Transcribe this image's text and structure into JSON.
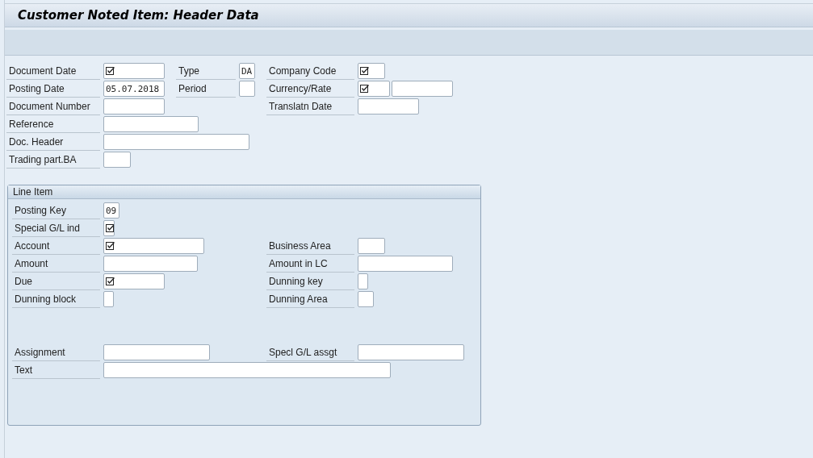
{
  "window": {
    "title": "Customer Noted Item: Header Data"
  },
  "header": {
    "rows": [
      {
        "left": {
          "label": "Document Date",
          "inputs": [
            {
              "required": true
            }
          ]
        },
        "middle": {
          "label": "Type",
          "inputs": [
            {
              "value": "DA",
              "required": false
            }
          ]
        },
        "right": {
          "label": "Company Code",
          "inputs": [
            {
              "required": true
            }
          ]
        }
      },
      {
        "left": {
          "label": "Posting Date",
          "inputs": [
            {
              "value": "05.07.2018",
              "required": false
            }
          ]
        },
        "middle": {
          "label": "Period",
          "inputs": [
            {
              "required": false
            }
          ]
        },
        "right": {
          "label": "Currency/Rate",
          "inputs": [
            {
              "required": true
            },
            {
              "required": false
            }
          ]
        }
      },
      {
        "left": {
          "label": "Document Number",
          "inputs": [
            {
              "required": false
            }
          ]
        },
        "right": {
          "label": "Translatn Date",
          "inputs": [
            {
              "required": false
            }
          ]
        }
      },
      {
        "left": {
          "label": "Reference",
          "inputs": [
            {
              "required": false
            }
          ]
        }
      },
      {
        "left": {
          "label": "Doc. Header",
          "inputs": [
            {
              "required": false
            }
          ]
        }
      },
      {
        "left": {
          "label": "Trading part.BA",
          "inputs": [
            {
              "required": false
            }
          ]
        }
      }
    ]
  },
  "line_item": {
    "title": "Line Item",
    "rows": [
      {
        "left": {
          "label": "Posting Key",
          "inputs": [
            {
              "value": "09",
              "required": false
            }
          ]
        }
      },
      {
        "left": {
          "label": "Special G/L ind",
          "inputs": [
            {
              "required": true
            }
          ]
        }
      },
      {
        "left": {
          "label": "Account",
          "inputs": [
            {
              "required": true
            }
          ]
        },
        "right": {
          "label": "Business Area",
          "inputs": [
            {
              "required": false
            }
          ]
        }
      },
      {
        "left": {
          "label": "Amount",
          "inputs": [
            {
              "required": false
            }
          ]
        },
        "right": {
          "label": "Amount in LC",
          "inputs": [
            {
              "required": false
            }
          ]
        }
      },
      {
        "left": {
          "label": "Due",
          "inputs": [
            {
              "required": true
            }
          ]
        },
        "right": {
          "label": "Dunning key",
          "inputs": [
            {
              "required": false
            }
          ]
        }
      },
      {
        "left": {
          "label": "Dunning block",
          "inputs": [
            {
              "required": false
            }
          ]
        },
        "right": {
          "label": "Dunning Area",
          "inputs": [
            {
              "required": false
            }
          ]
        }
      }
    ],
    "bottom_rows": [
      {
        "left": {
          "label": "Assignment",
          "inputs": [
            {
              "required": false
            }
          ]
        },
        "right": {
          "label": "Specl G/L assgt",
          "inputs": [
            {
              "required": false
            }
          ]
        }
      },
      {
        "left": {
          "label": "Text",
          "inputs": [
            {
              "required": false
            }
          ]
        }
      }
    ]
  }
}
